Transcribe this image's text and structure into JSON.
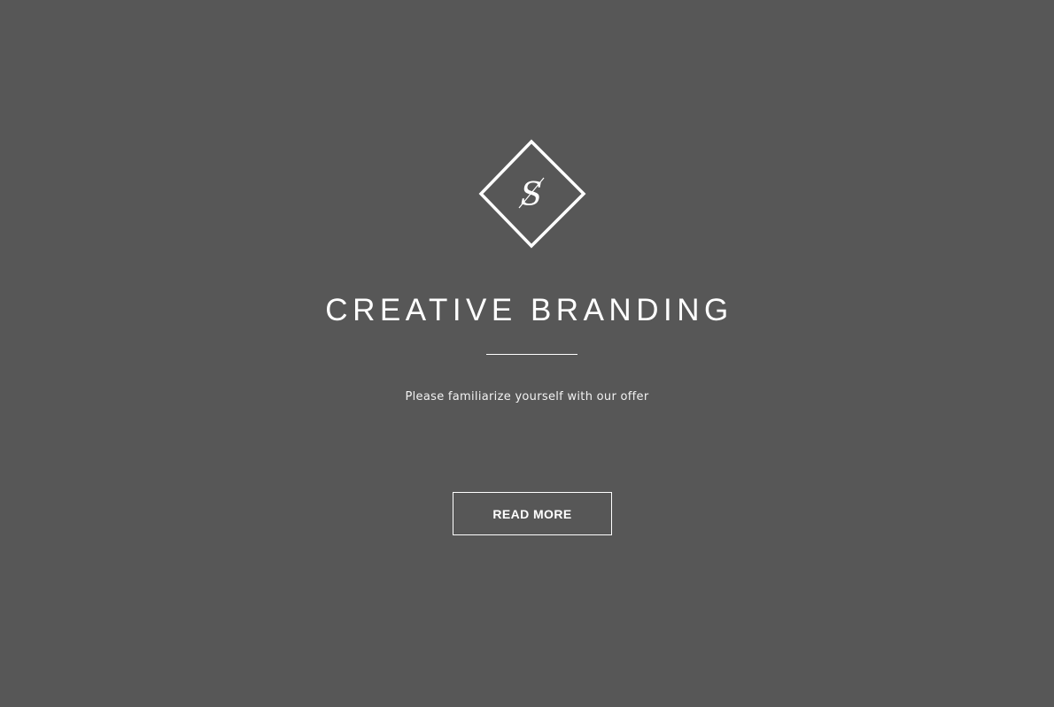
{
  "hero": {
    "logo": {
      "icon": "diamond-s-logo-icon",
      "letter": "S"
    },
    "title": "CREATIVE BRANDING",
    "subtitle": "Please familiarize yourself with our offer",
    "button_label": "READ MORE"
  },
  "colors": {
    "background": "#575757",
    "foreground": "#ffffff"
  }
}
